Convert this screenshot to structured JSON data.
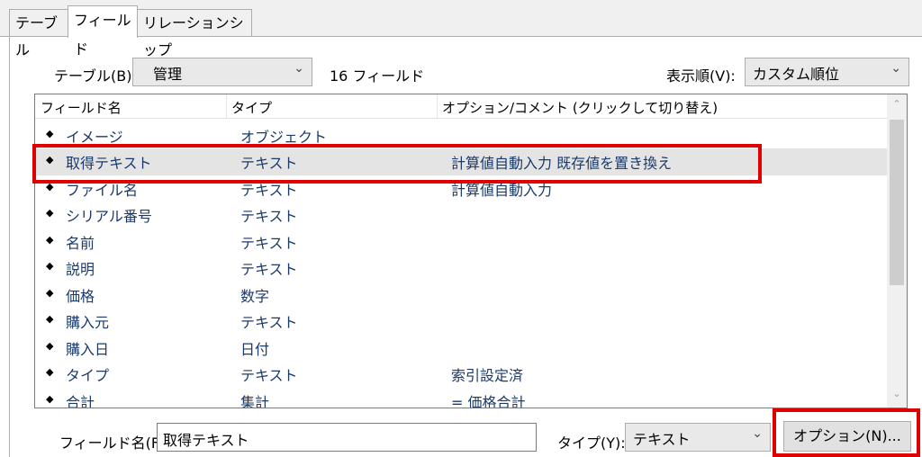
{
  "tabs": [
    {
      "label": "テーブル",
      "active": false
    },
    {
      "label": "フィールド",
      "active": true
    },
    {
      "label": "リレーションシップ",
      "active": false
    }
  ],
  "table_label": "テーブル(B):",
  "table_value": "管理",
  "field_count": "16 フィールド",
  "order_label": "表示順(V):",
  "order_value": "カスタム順位",
  "columns": {
    "name": "フィールド名",
    "type": "タイプ",
    "options": "オプション/コメント (クリックして切り替え)"
  },
  "rows": [
    {
      "name": "イメージ",
      "type": "オブジェクト",
      "options": ""
    },
    {
      "name": "取得テキスト",
      "type": "テキスト",
      "options": "計算値自動入力 既存値を置き換え"
    },
    {
      "name": "ファイル名",
      "type": "テキスト",
      "options": "計算値自動入力"
    },
    {
      "name": "シリアル番号",
      "type": "テキスト",
      "options": ""
    },
    {
      "name": "名前",
      "type": "テキスト",
      "options": ""
    },
    {
      "name": "説明",
      "type": "テキスト",
      "options": ""
    },
    {
      "name": "価格",
      "type": "数字",
      "options": ""
    },
    {
      "name": "購入元",
      "type": "テキスト",
      "options": ""
    },
    {
      "name": "購入日",
      "type": "日付",
      "options": ""
    },
    {
      "name": "タイプ",
      "type": "テキスト",
      "options": "索引設定済"
    },
    {
      "name": "合計",
      "type": "集計",
      "options": "= 価格合計"
    }
  ],
  "selected_row": 1,
  "field_name_label": "フィールド名(F):",
  "field_name_value": "取得テキスト",
  "type_label": "タイプ(Y):",
  "type_value": "テキスト",
  "options_button": "オプション(N)...",
  "icons": {
    "diamond": "◆",
    "chevron_down": "⌄",
    "scroll_up": "⌃",
    "scroll_down": "⌄"
  },
  "colors": {
    "highlight": "#e00000",
    "row_text": "#1a3a6b"
  }
}
